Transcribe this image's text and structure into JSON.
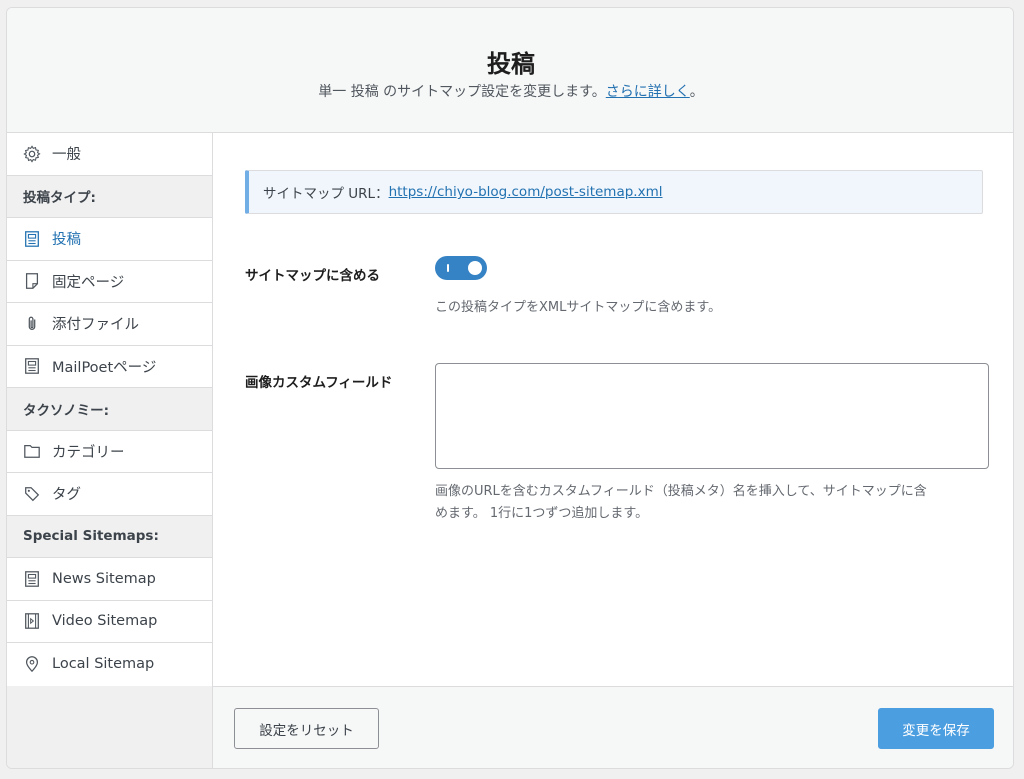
{
  "header": {
    "title": "投稿",
    "description_prefix": "単一 投稿 のサイトマップ設定を変更します。",
    "learn_more": "さらに詳しく",
    "description_suffix": "。"
  },
  "sidebar": {
    "general": "一般",
    "group_post_types": "投稿タイプ:",
    "posts": "投稿",
    "pages": "固定ページ",
    "attachments": "添付ファイル",
    "mailpoet": "MailPoetページ",
    "group_taxonomies": "タクソノミー:",
    "categories": "カテゴリー",
    "tags": "タグ",
    "group_special": "Special Sitemaps:",
    "news": "News Sitemap",
    "video": "Video Sitemap",
    "local": "Local Sitemap"
  },
  "main": {
    "url_label": "サイトマップ URL：",
    "url": "https://chiyo-blog.com/post-sitemap.xml",
    "include_label": "サイトマップに含める",
    "include_enabled": true,
    "include_help": "この投稿タイプをXMLサイトマップに含めます。",
    "image_fields_label": "画像カスタムフィールド",
    "image_fields_value": "",
    "image_fields_help_1": "画像のURLを含むカスタムフィールド（投稿メタ）名を挿入して、サイトマップに含",
    "image_fields_help_2": "めます。 1行に1つずつ追加します。"
  },
  "footer": {
    "reset_label": "設定をリセット",
    "save_label": "変更を保存"
  },
  "colors": {
    "accent": "#2271b1",
    "toggle_on": "#3582c4",
    "save_button": "#4b9ee0"
  }
}
